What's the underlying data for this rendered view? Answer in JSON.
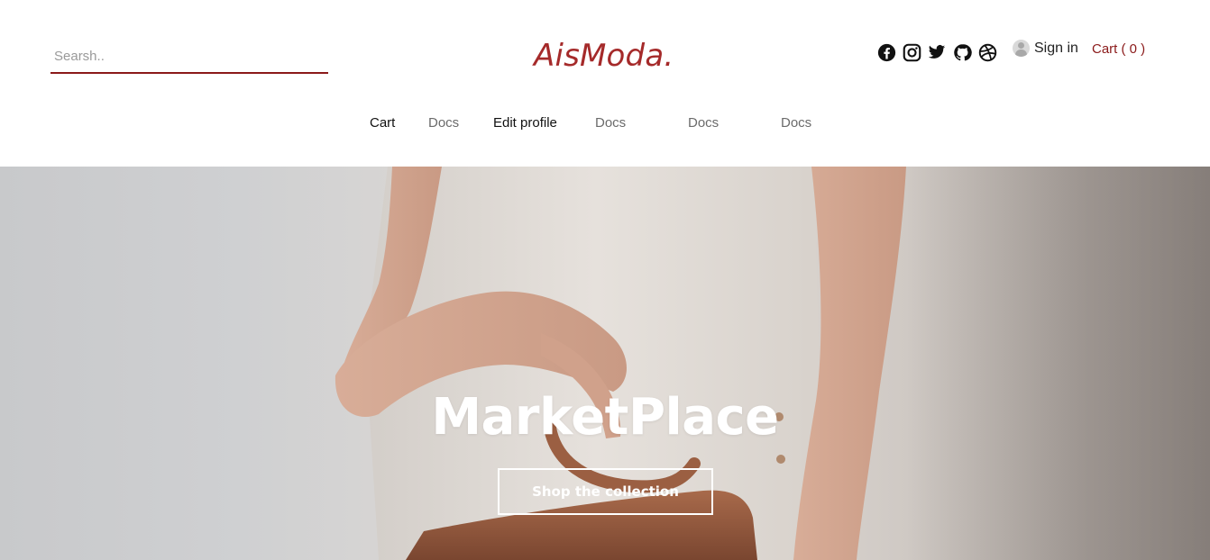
{
  "search": {
    "placeholder": "Searsh.."
  },
  "brand": {
    "logo": "AisModa.",
    "color": "#a52a2a"
  },
  "social": [
    {
      "icon": "facebook-icon"
    },
    {
      "icon": "instagram-icon"
    },
    {
      "icon": "twitter-icon"
    },
    {
      "icon": "github-icon"
    },
    {
      "icon": "dribbble-icon"
    }
  ],
  "account": {
    "signin_label": "Sign in",
    "avatar_icon": "user-avatar-icon"
  },
  "cart": {
    "label": "Cart ( 0 )",
    "color": "#8b1a1a"
  },
  "nav": {
    "items": [
      {
        "label": "Cart",
        "active": true
      },
      {
        "label": "Docs",
        "active": false
      },
      {
        "label": "Edit profile",
        "active": true
      },
      {
        "label": "Docs",
        "active": false
      },
      {
        "label": "Docs",
        "active": false
      },
      {
        "label": "Docs",
        "active": false
      }
    ]
  },
  "hero": {
    "title": "MarketPlace",
    "cta_label": "Shop the collection"
  }
}
